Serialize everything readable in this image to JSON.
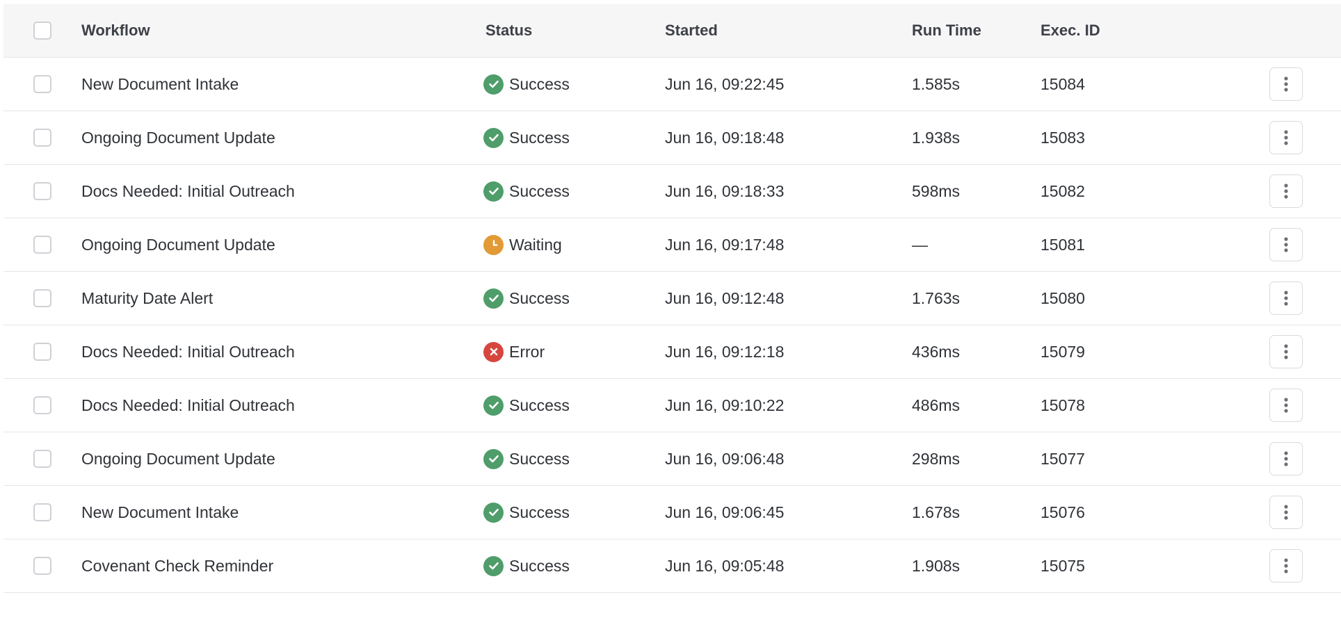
{
  "colors": {
    "success": "#4f9d6a",
    "waiting": "#e29a34",
    "error": "#d6463f",
    "header_bg": "#f6f6f7",
    "border": "#e4e5e8"
  },
  "table": {
    "headers": {
      "workflow": "Workflow",
      "status": "Status",
      "started": "Started",
      "run_time": "Run Time",
      "exec_id": "Exec. ID"
    },
    "rows": [
      {
        "workflow": "New Document Intake",
        "status": "Success",
        "status_icon": "check-circle-icon",
        "started": "Jun 16, 09:22:45",
        "run_time": "1.585s",
        "exec_id": "15084"
      },
      {
        "workflow": "Ongoing Document Update",
        "status": "Success",
        "status_icon": "check-circle-icon",
        "started": "Jun 16, 09:18:48",
        "run_time": "1.938s",
        "exec_id": "15083"
      },
      {
        "workflow": "Docs Needed: Initial Outreach",
        "status": "Success",
        "status_icon": "check-circle-icon",
        "started": "Jun 16, 09:18:33",
        "run_time": "598ms",
        "exec_id": "15082"
      },
      {
        "workflow": "Ongoing Document Update",
        "status": "Waiting",
        "status_icon": "clock-icon",
        "started": "Jun 16, 09:17:48",
        "run_time": "—",
        "exec_id": "15081"
      },
      {
        "workflow": "Maturity Date Alert",
        "status": "Success",
        "status_icon": "check-circle-icon",
        "started": "Jun 16, 09:12:48",
        "run_time": "1.763s",
        "exec_id": "15080"
      },
      {
        "workflow": "Docs Needed: Initial Outreach",
        "status": "Error",
        "status_icon": "x-circle-icon",
        "started": "Jun 16, 09:12:18",
        "run_time": "436ms",
        "exec_id": "15079"
      },
      {
        "workflow": "Docs Needed: Initial Outreach",
        "status": "Success",
        "status_icon": "check-circle-icon",
        "started": "Jun 16, 09:10:22",
        "run_time": "486ms",
        "exec_id": "15078"
      },
      {
        "workflow": "Ongoing Document Update",
        "status": "Success",
        "status_icon": "check-circle-icon",
        "started": "Jun 16, 09:06:48",
        "run_time": "298ms",
        "exec_id": "15077"
      },
      {
        "workflow": "New Document Intake",
        "status": "Success",
        "status_icon": "check-circle-icon",
        "started": "Jun 16, 09:06:45",
        "run_time": "1.678s",
        "exec_id": "15076"
      },
      {
        "workflow": "Covenant Check Reminder",
        "status": "Success",
        "status_icon": "check-circle-icon",
        "started": "Jun 16, 09:05:48",
        "run_time": "1.908s",
        "exec_id": "15075"
      }
    ]
  }
}
